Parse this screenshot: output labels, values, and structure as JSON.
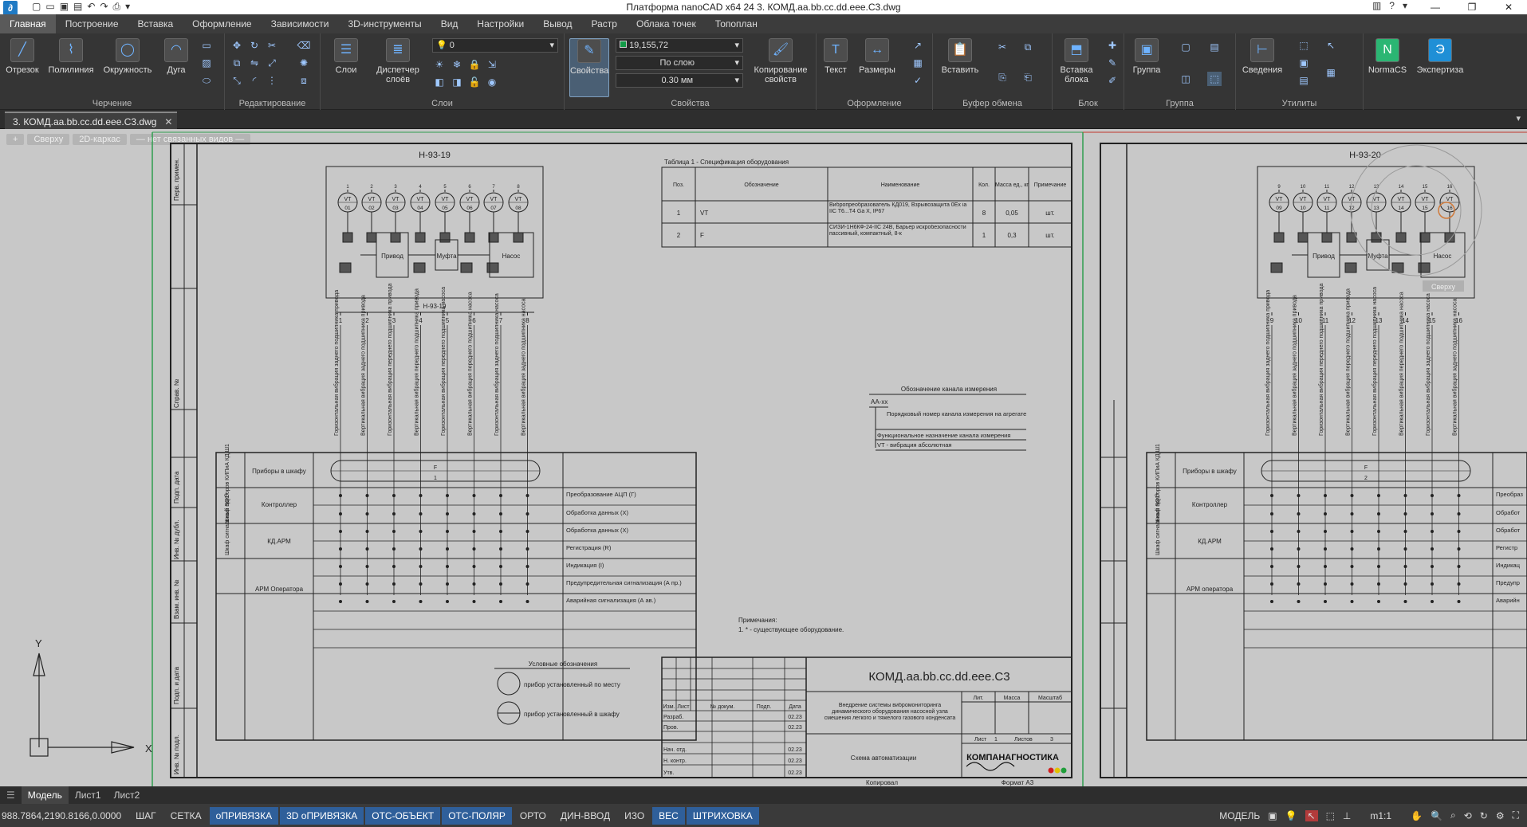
{
  "window": {
    "title": "Платформа nanoCAD x64 24 3. КОМД.аа.bb.cc.dd.eee.C3.dwg"
  },
  "menu": [
    "Главная",
    "Построение",
    "Вставка",
    "Оформление",
    "Зависимости",
    "3D-инструменты",
    "Вид",
    "Настройки",
    "Вывод",
    "Растр",
    "Облака точек",
    "Топоплан"
  ],
  "ribbon": {
    "groups": {
      "draw": "Черчение",
      "edit": "Редактирование",
      "layers": "Слои",
      "props": "Свойства",
      "annot": "Оформление",
      "clip": "Буфер обмена",
      "block": "Блок",
      "group": "Группа",
      "util": "Утилиты"
    },
    "buttons": {
      "line": "Отрезок",
      "polyline": "Полилиния",
      "circle": "Окружность",
      "arc": "Дуга",
      "layers": "Слои",
      "layer_mgr": "Диспетчер слоёв",
      "properties": "Свойства",
      "copy_props": "Копирование свойств",
      "text": "Текст",
      "dims": "Размеры",
      "paste": "Вставить",
      "insert_block": "Вставка блока",
      "group": "Группа",
      "summary": "Сведения",
      "normacs": "NormaCS",
      "expertise": "Экспертиза"
    },
    "layer_value": "0",
    "color_value": "19,155,72",
    "linetype_value": "По слою",
    "lineweight_value": "0.30 мм"
  },
  "doc_tab": "3. КОМД.аа.bb.cc.dd.eee.C3.dwg",
  "view_controls": [
    "+",
    "Сверху",
    "2D-каркас",
    "— нет связанных видов —"
  ],
  "drawing": {
    "sheet1_title": "Н-93-19",
    "sheet2_title": "Н-93-20",
    "sensors1": [
      "01",
      "02",
      "03",
      "04",
      "05",
      "06",
      "07",
      "08"
    ],
    "sensors2": [
      "09",
      "10",
      "11",
      "12",
      "13",
      "14",
      "15",
      "16"
    ],
    "cols1": [
      "1",
      "2",
      "3",
      "4",
      "5",
      "6",
      "7",
      "8"
    ],
    "cols2": [
      "9",
      "10",
      "11",
      "12",
      "13",
      "14",
      "15",
      "16"
    ],
    "sensor_label": "VT",
    "drive": "Привод",
    "coupling": "Муфта",
    "pump": "Насос",
    "spec_title": "Таблица 1 - Спецификация оборудования",
    "spec_headers": [
      "Поз.",
      "Обозначение",
      "Наименование",
      "Кол.",
      "Масса ед., кг",
      "Примечание"
    ],
    "spec_rows": [
      [
        "1",
        "VT",
        "Вибропреобразователь КД019, Взрывозащита 0Ex ia IIC T6...T4 Ga X, IP67",
        "8",
        "0,05",
        "шт."
      ],
      [
        "2",
        "F",
        "СИЗИ-1Н6КФ-24-IIC 24В, Барьер искробезопасности пассивный, компактный, 8-к",
        "1",
        "0,3",
        "шт."
      ]
    ],
    "vlabels": [
      "Горизонтальная вибрация заднего подшипника привода",
      "Вертикальная вибрация заднего подшипника привода",
      "Горизонтальная вибрация переднего подшипника привода",
      "Вертикальная вибрация переднего подшипника привода",
      "Горизонтальная вибрация переднего подшипника насоса",
      "Вертикальная вибрация переднего подшипника насоса",
      "Горизонтальная вибрация заднего подшипника насоса",
      "Вертикальная вибрация заднего подшипника насоса"
    ],
    "matrix_rows": [
      "Приборы в шкафу",
      "Контроллер",
      "КД.АРМ",
      "АРМ Оператора"
    ],
    "matrix_rows2": [
      "Приборы в шкафу",
      "Контроллер",
      "КД.АРМ",
      "АРМ оператора"
    ],
    "cab1": "Шкаф приборов КИПиА КД.Ш1",
    "cab2": "Шкаф сигнальный SQ1*",
    "funcs": [
      "Преобразование АЦП (Г)",
      "Обработка данных (Х)",
      "Обработка данных (Х)",
      "Регистрация (R)",
      "Индикация (I)",
      "Предупредительная сигнализация (А пр.)",
      "Аварийная сигнализация (А ав.)"
    ],
    "funcs2": [
      "Преобраз",
      "Обработ",
      "Обработ",
      "Регистр",
      "Индикац",
      "Предупр",
      "Аварийн"
    ],
    "bar1_top": "F",
    "bar1_bottom": "1",
    "bar2_bottom": "2",
    "legend_title": "Обозначение канала измерения",
    "legend_code": "АА-хх",
    "legend_items": [
      "Порядковый номер канала измерения на агрегате",
      "Функциональное назначение канала измерения",
      "VT - вибрация абсолютная"
    ],
    "notes": [
      "Примечания:",
      "1. * - существующее оборудование."
    ],
    "conv_title": "Условные обозначения",
    "conv_items": [
      "прибор установленный по месту",
      "прибор установленный в шкафу"
    ],
    "stamp_code": "КОМД.аа.bb.cc.dd.eee.C3",
    "stamp_desc": "Внедрение системы вибромониторинга динамического оборудования насосной узла смешения легкого и тяжелого газового конденсата",
    "stamp_sheetname": "Схема автоматизации",
    "stamp_cols": [
      "Лит.",
      "Масса",
      "Масштаб"
    ],
    "stamp_sheet": [
      "Лист",
      "1",
      "Листов",
      "3"
    ],
    "stamp_left_headers": [
      "Изм.",
      "Лист",
      "№ докум.",
      "Подп.",
      "Дата"
    ],
    "stamp_roles": [
      "Разраб.",
      "Пров.",
      "",
      "Нач. отд.",
      "Н. контр.",
      "Утв."
    ],
    "stamp_dates": [
      "02.23",
      "02.23",
      "",
      "02.23",
      "02.23",
      "02.23"
    ],
    "copied": "Копировал",
    "format": "Формат А3",
    "logo": "КОМПАНАГНОСТИКА",
    "side_labels": [
      "Перв. примен.",
      "Справ. №",
      "Подп. дата",
      "Инв. № дубл.",
      "Взам. инв. №",
      "Подп. и дата",
      "Инв. № подл."
    ],
    "viewcube_label": "Сверху"
  },
  "bottom_tabs": [
    "Модель",
    "Лист1",
    "Лист2"
  ],
  "status": {
    "coords": "988.7864,2190.8166,0.0000",
    "toggles": [
      {
        "label": "ШАГ",
        "on": false
      },
      {
        "label": "СЕТКА",
        "on": false
      },
      {
        "label": "оПРИВЯЗКА",
        "on": true
      },
      {
        "label": "3D оПРИВЯЗКА",
        "on": true
      },
      {
        "label": "ОТС-ОБЪЕКТ",
        "on": true
      },
      {
        "label": "ОТС-ПОЛЯР",
        "on": true
      },
      {
        "label": "ОРТО",
        "on": false
      },
      {
        "label": "ДИН-ВВОД",
        "on": false
      },
      {
        "label": "ИЗО",
        "on": false
      },
      {
        "label": "ВЕС",
        "on": true
      },
      {
        "label": "ШТРИХОВКА",
        "on": true
      }
    ],
    "mode": "МОДЕЛЬ",
    "scale": "m1:1"
  }
}
